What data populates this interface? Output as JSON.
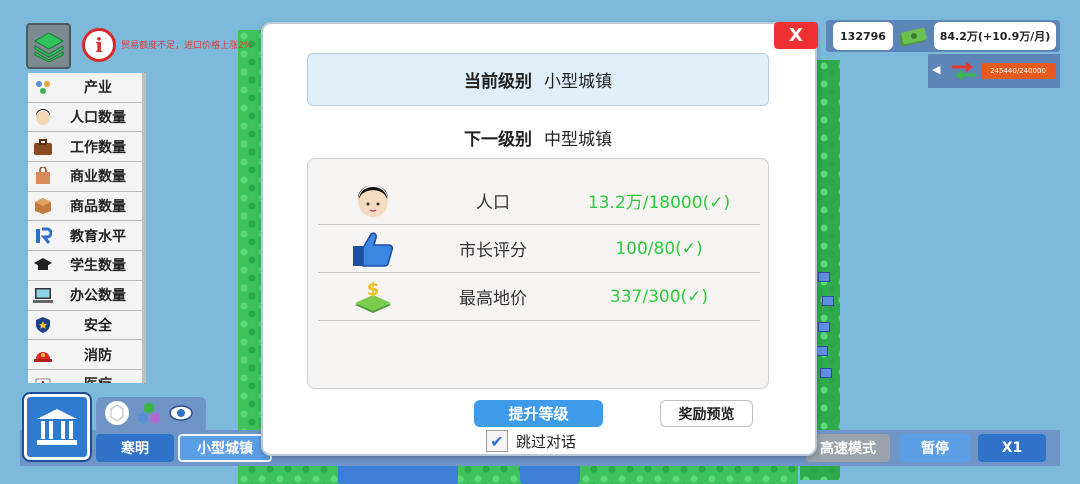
{
  "header": {
    "trade_message": "贸易额度不足，进口价格上涨2%",
    "info_icon": "info-icon",
    "layers_icon": "layers-icon"
  },
  "sidebar": {
    "items": [
      {
        "label": "产业",
        "icon": "industry-icon"
      },
      {
        "label": "人口数量",
        "icon": "person-icon"
      },
      {
        "label": "工作数量",
        "icon": "briefcase-icon"
      },
      {
        "label": "商业数量",
        "icon": "shopping-bag-icon"
      },
      {
        "label": "商品数量",
        "icon": "box-icon"
      },
      {
        "label": "教育水平",
        "icon": "education-icon"
      },
      {
        "label": "学生数量",
        "icon": "graduation-cap-icon"
      },
      {
        "label": "办公数量",
        "icon": "computer-icon"
      },
      {
        "label": "安全",
        "icon": "police-badge-icon"
      },
      {
        "label": "消防",
        "icon": "fire-helmet-icon"
      },
      {
        "label": "医疗",
        "icon": "medical-icon"
      }
    ]
  },
  "stats": {
    "population": "132796",
    "money": "84.2万(+10.9万/月)",
    "trade_progress": "245440/240000"
  },
  "bottom_bar": {
    "city_name_btn": "寒明",
    "level_btn": "小型城镇",
    "speed_mode_btn": "高速模式",
    "pause_btn": "暂停",
    "speed_btn": "X1"
  },
  "modal": {
    "close_label": "X",
    "current_level_label": "当前级别",
    "current_level_value": "小型城镇",
    "next_level_label": "下一级别",
    "next_level_value": "中型城镇",
    "requirements": [
      {
        "name": "人口",
        "value": "13.2万/18000(✓)",
        "icon": "person-face-icon"
      },
      {
        "name": "市长评分",
        "value": "100/80(✓)",
        "icon": "thumbs-up-icon"
      },
      {
        "name": "最高地价",
        "value": "337/300(✓)",
        "icon": "land-price-icon"
      }
    ],
    "upgrade_button": "提升等级",
    "reward_button": "奖励预览",
    "skip_dialog_label": "跳过对话",
    "skip_dialog_checked": true
  },
  "colors": {
    "accent": "#3e9be9",
    "success": "#2ccd3a",
    "danger": "#ee3030"
  }
}
